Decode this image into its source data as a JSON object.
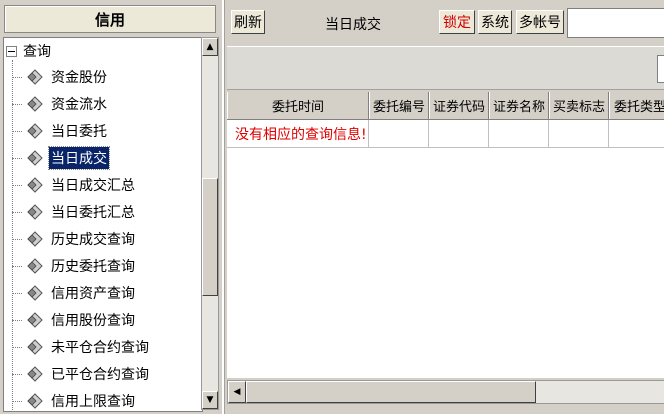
{
  "left_panel": {
    "title": "信用",
    "tree": {
      "root_label": "查询",
      "items": [
        {
          "label": "资金股份"
        },
        {
          "label": "资金流水"
        },
        {
          "label": "当日委托"
        },
        {
          "label": "当日成交",
          "selected": true
        },
        {
          "label": "当日成交汇总"
        },
        {
          "label": "当日委托汇总"
        },
        {
          "label": "历史成交查询"
        },
        {
          "label": "历史委托查询"
        },
        {
          "label": "信用资产查询"
        },
        {
          "label": "信用股份查询"
        },
        {
          "label": "未平仓合约查询"
        },
        {
          "label": "已平仓合约查询"
        },
        {
          "label": "信用上限查询"
        }
      ]
    }
  },
  "toolbar": {
    "refresh_label": "刷新",
    "title": "当日成交",
    "lock_label": "锁定",
    "system_label": "系统",
    "multi_account_label": "多帐号"
  },
  "table": {
    "columns": [
      "委托时间",
      "委托编号",
      "证券代码",
      "证券名称",
      "买卖标志",
      "委托类型"
    ],
    "empty_message": "没有相应的查询信息!"
  },
  "colors": {
    "accent_red": "#d40000",
    "selection": "#0a246a"
  },
  "icons": {
    "tree_collapse": "minus-box-icon",
    "tree_leaf": "diamond-leaf-icon",
    "scroll_up": "arrow-up-icon",
    "scroll_down": "arrow-down-icon",
    "scroll_left": "arrow-left-icon"
  }
}
